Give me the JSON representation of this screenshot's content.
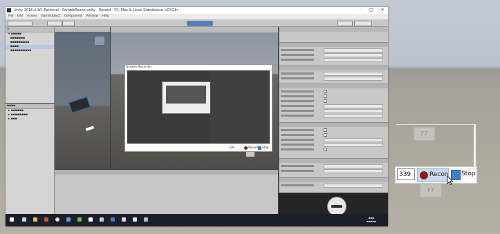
{
  "screen": {
    "window_title": "Unity 2018.4.1f1 Personal - SampleScene.unity - Record - PC, Mac & Linux Standalone <DX11>",
    "menu": [
      "File",
      "Edit",
      "Assets",
      "GameObject",
      "Component",
      "Window",
      "Help"
    ],
    "nested_window_title": "Screen Recorder",
    "nested_counter": "339",
    "nested_record_label": "Record",
    "nested_stop_label": "Stop"
  },
  "recorder": {
    "counter": "339",
    "record_label": "Record",
    "stop_label": "Stop",
    "ghost_label_top": "F7",
    "ghost_label_bottom": "F7"
  },
  "colors": {
    "record": "#8e1d15",
    "stop": "#3f7fc6",
    "record_button_bg": "#c9d9ef"
  },
  "icons": [
    "record-icon",
    "stop-icon",
    "cursor-icon",
    "windows-start-icon"
  ]
}
